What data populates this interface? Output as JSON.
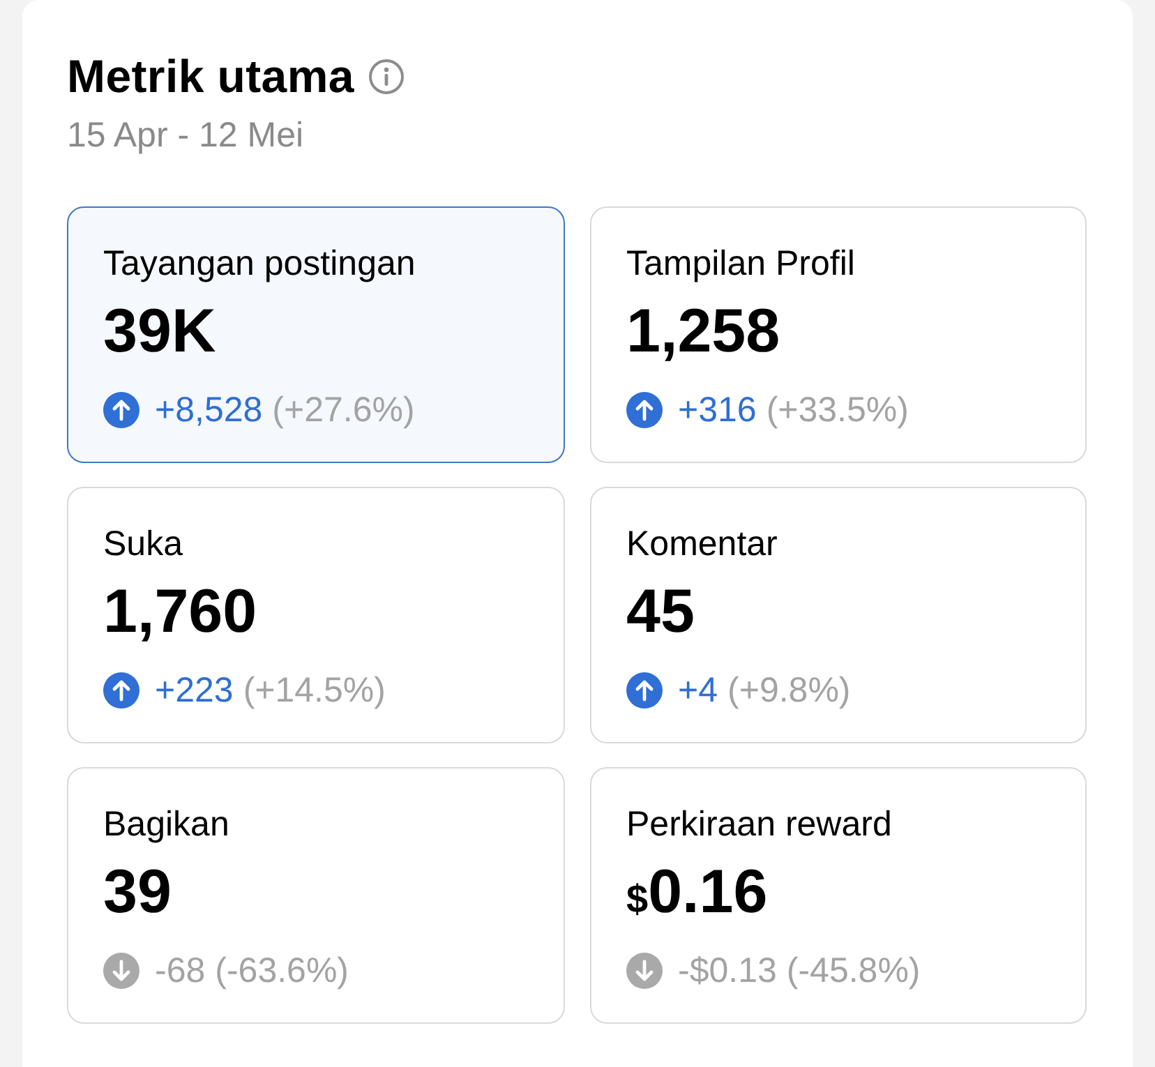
{
  "header": {
    "title": "Metrik utama",
    "date_range": "15 Apr - 12 Mei"
  },
  "metrics": [
    {
      "label": "Tayangan postingan",
      "value": "39K",
      "kind": "up",
      "delta": "+8,528",
      "percent": "(+27.6%)",
      "selected": true
    },
    {
      "label": "Tampilan Profil",
      "value": "1,258",
      "kind": "up",
      "delta": "+316",
      "percent": "(+33.5%)",
      "selected": false
    },
    {
      "label": "Suka",
      "value": "1,760",
      "kind": "up",
      "delta": "+223",
      "percent": "(+14.5%)",
      "selected": false
    },
    {
      "label": "Komentar",
      "value": "45",
      "kind": "up",
      "delta": "+4",
      "percent": "(+9.8%)",
      "selected": false
    },
    {
      "label": "Bagikan",
      "value": "39",
      "kind": "down",
      "delta": "-68",
      "percent": "(-63.6%)",
      "selected": false
    },
    {
      "label": "Perkiraan reward",
      "currency": "$",
      "value": "0.16",
      "kind": "down",
      "delta": "-$0.13",
      "percent": "(-45.8%)",
      "selected": false
    }
  ]
}
